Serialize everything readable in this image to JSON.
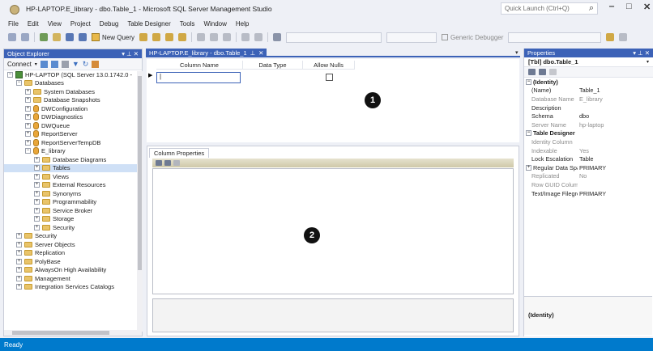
{
  "window": {
    "title": "HP-LAPTOP.E_library - dbo.Table_1 - Microsoft SQL Server Management Studio",
    "quick_launch_placeholder": "Quick Launch (Ctrl+Q)"
  },
  "menu": [
    "File",
    "Edit",
    "View",
    "Project",
    "Debug",
    "Table Designer",
    "Tools",
    "Window",
    "Help"
  ],
  "toolbar": {
    "new_query": "New Query",
    "generic_debugger": "Generic Debugger"
  },
  "object_explorer": {
    "title": "Object Explorer",
    "connect": "Connect",
    "tree": [
      {
        "label": "HP-LAPTOP (SQL Server 13.0.1742.0 -",
        "level": 0,
        "exp": "−",
        "icon": "server"
      },
      {
        "label": "Databases",
        "level": 1,
        "exp": "−",
        "icon": "folder"
      },
      {
        "label": "System Databases",
        "level": 2,
        "exp": "+",
        "icon": "folder"
      },
      {
        "label": "Database Snapshots",
        "level": 2,
        "exp": "+",
        "icon": "folder"
      },
      {
        "label": "DWConfiguration",
        "level": 2,
        "exp": "+",
        "icon": "db"
      },
      {
        "label": "DWDiagnostics",
        "level": 2,
        "exp": "+",
        "icon": "db"
      },
      {
        "label": "DWQueue",
        "level": 2,
        "exp": "+",
        "icon": "db"
      },
      {
        "label": "ReportServer",
        "level": 2,
        "exp": "+",
        "icon": "db"
      },
      {
        "label": "ReportServerTempDB",
        "level": 2,
        "exp": "+",
        "icon": "db"
      },
      {
        "label": "E_library",
        "level": 2,
        "exp": "−",
        "icon": "db"
      },
      {
        "label": "Database Diagrams",
        "level": 3,
        "exp": "+",
        "icon": "folder"
      },
      {
        "label": "Tables",
        "level": 3,
        "exp": "+",
        "icon": "folder",
        "selected": true
      },
      {
        "label": "Views",
        "level": 3,
        "exp": "+",
        "icon": "folder"
      },
      {
        "label": "External Resources",
        "level": 3,
        "exp": "+",
        "icon": "folder"
      },
      {
        "label": "Synonyms",
        "level": 3,
        "exp": "+",
        "icon": "folder"
      },
      {
        "label": "Programmability",
        "level": 3,
        "exp": "+",
        "icon": "folder"
      },
      {
        "label": "Service Broker",
        "level": 3,
        "exp": "+",
        "icon": "folder"
      },
      {
        "label": "Storage",
        "level": 3,
        "exp": "+",
        "icon": "folder"
      },
      {
        "label": "Security",
        "level": 3,
        "exp": "+",
        "icon": "folder"
      },
      {
        "label": "Security",
        "level": 1,
        "exp": "+",
        "icon": "folder"
      },
      {
        "label": "Server Objects",
        "level": 1,
        "exp": "+",
        "icon": "folder"
      },
      {
        "label": "Replication",
        "level": 1,
        "exp": "+",
        "icon": "folder"
      },
      {
        "label": "PolyBase",
        "level": 1,
        "exp": "+",
        "icon": "folder"
      },
      {
        "label": "AlwaysOn High Availability",
        "level": 1,
        "exp": "+",
        "icon": "folder"
      },
      {
        "label": "Management",
        "level": 1,
        "exp": "+",
        "icon": "folder"
      },
      {
        "label": "Integration Services Catalogs",
        "level": 1,
        "exp": "+",
        "icon": "folder"
      }
    ]
  },
  "designer": {
    "tab_label": "HP-LAPTOP.E_library - dbo.Table_1",
    "columns": [
      "Column Name",
      "Data Type",
      "Allow Nulls"
    ],
    "badge1": "1",
    "badge2": "2",
    "column_properties_tab": "Column Properties"
  },
  "properties": {
    "title": "Properties",
    "object": "[Tbl] dbo.Table_1",
    "rows": [
      {
        "type": "cat",
        "exp": "−",
        "name": "(Identity)"
      },
      {
        "type": "prop",
        "name": "(Name)",
        "value": "Table_1",
        "grey": false
      },
      {
        "type": "prop",
        "name": "Database Name",
        "value": "E_library",
        "grey": true
      },
      {
        "type": "prop",
        "name": "Description",
        "value": "",
        "grey": false
      },
      {
        "type": "prop",
        "name": "Schema",
        "value": "dbo",
        "grey": false
      },
      {
        "type": "prop",
        "name": "Server Name",
        "value": "hp-laptop",
        "grey": true
      },
      {
        "type": "cat",
        "exp": "−",
        "name": "Table Designer"
      },
      {
        "type": "prop",
        "name": "Identity Column",
        "value": "",
        "grey": true
      },
      {
        "type": "prop",
        "name": "Indexable",
        "value": "Yes",
        "grey": true
      },
      {
        "type": "prop",
        "name": "Lock Escalation",
        "value": "Table",
        "grey": false
      },
      {
        "type": "subcat",
        "exp": "+",
        "name": "Regular Data Space",
        "value": "PRIMARY"
      },
      {
        "type": "prop",
        "name": "Replicated",
        "value": "No",
        "grey": true
      },
      {
        "type": "prop",
        "name": "Row GUID Column",
        "value": "",
        "grey": true
      },
      {
        "type": "prop",
        "name": "Text/Image Filegroup",
        "value": "PRIMARY",
        "grey": false
      }
    ],
    "description_title": "(Identity)"
  },
  "status": "Ready",
  "colors": {
    "accent": "#3c62b7",
    "status_bar": "#007acc"
  }
}
